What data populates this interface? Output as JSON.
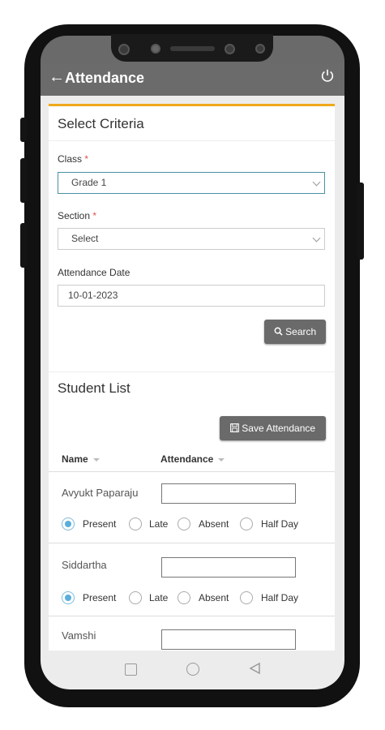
{
  "appbar": {
    "title": "Attendance"
  },
  "criteria": {
    "title": "Select Criteria",
    "class_label": "Class",
    "class_value": "Grade 1",
    "section_label": "Section",
    "section_value": "Select",
    "date_label": "Attendance Date",
    "date_value": "10-01-2023",
    "required_mark": "*",
    "search_button": "Search"
  },
  "student_list": {
    "title": "Student List",
    "save_button": "Save Attendance",
    "columns": [
      "Name",
      "Attendance"
    ],
    "options": [
      "Present",
      "Late",
      "Absent",
      "Half Day"
    ],
    "students": [
      {
        "name": "Avyukt Paparaju",
        "selected": "Present"
      },
      {
        "name": "Siddartha",
        "selected": "Present"
      },
      {
        "name": "Vamshi",
        "selected": ""
      }
    ]
  },
  "icons": {
    "back": "arrow-left-icon",
    "power": "power-icon",
    "search": "search-icon",
    "save": "save-icon"
  },
  "colors": {
    "accent": "#f0a81c",
    "appbar": "#6b6b6b",
    "radio_checked": "#5aaedc"
  }
}
